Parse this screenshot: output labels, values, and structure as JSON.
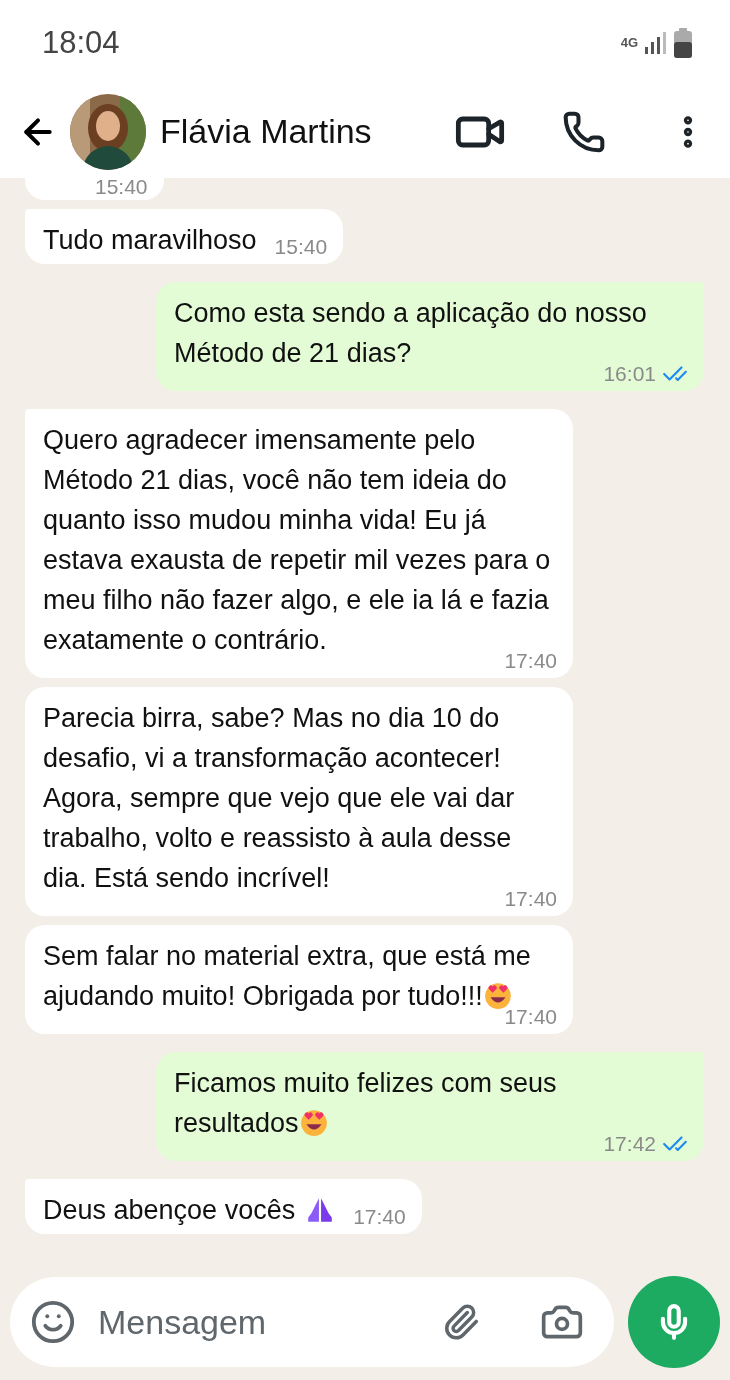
{
  "status_bar": {
    "time": "18:04",
    "network": "4G"
  },
  "header": {
    "contact_name": "Flávia Martins"
  },
  "messages": [
    {
      "outgoing": false,
      "partial": true,
      "time": "15:40"
    },
    {
      "outgoing": false,
      "partial": false,
      "text": "Tudo maravilhoso",
      "time": "15:40"
    },
    {
      "outgoing": true,
      "partial": false,
      "text": "Como esta sendo a aplicação do nosso Método de 21 dias?",
      "time": "16:01",
      "read": true
    },
    {
      "outgoing": false,
      "partial": false,
      "text": "Quero agradecer imensamente pelo Método 21 dias, você não tem ideia do quanto isso mudou minha vida! Eu já estava exausta de repetir mil vezes para o meu filho não fazer algo, e ele ia lá e fazia exatamente o contrário.",
      "time": "17:40"
    },
    {
      "outgoing": false,
      "partial": false,
      "text": "Parecia birra, sabe? Mas no dia 10 do desafio, vi a transformação acontecer! Agora, sempre que vejo que ele vai dar trabalho, volto e reassisto à aula desse dia. Está sendo incrível!",
      "time": "17:40"
    },
    {
      "outgoing": false,
      "partial": false,
      "text": "Sem falar no material extra, que está me ajudando muito! Obrigada por tudo!!!",
      "emoji": {
        "kind": "heart_eyes"
      },
      "time": "17:40"
    },
    {
      "outgoing": true,
      "partial": false,
      "text": "Ficamos muito felizes com seus resultados",
      "emoji": {
        "kind": "heart_eyes"
      },
      "time": "17:42",
      "read": true
    },
    {
      "outgoing": false,
      "partial": false,
      "text": "Deus abençoe vocês",
      "emoji": {
        "kind": "praying_hands"
      },
      "time": "17:40"
    }
  ],
  "composer": {
    "placeholder": "Mensagem"
  }
}
